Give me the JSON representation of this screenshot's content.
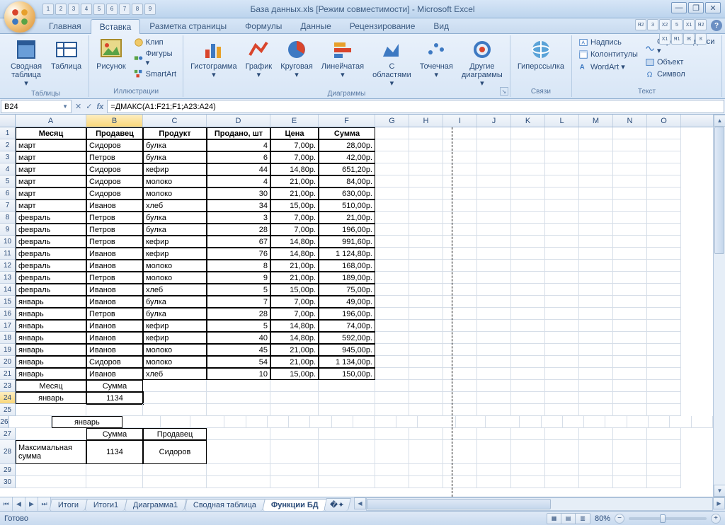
{
  "title": "База данных.xls  [Режим совместимости] - Microsoft Excel",
  "qat": [
    "1",
    "2",
    "3",
    "4",
    "5",
    "6",
    "7",
    "8",
    "9"
  ],
  "qat2": [
    "Я2",
    "3",
    "Х2",
    "5",
    "Х1",
    "Я2"
  ],
  "qat3": [
    "Х1",
    "Я1",
    "Ж",
    "К"
  ],
  "tabs": [
    "Главная",
    "Вставка",
    "Разметка страницы",
    "Формулы",
    "Данные",
    "Рецензирование",
    "Вид"
  ],
  "active_tab": 1,
  "ribbon": {
    "groups": [
      {
        "label": "Таблицы",
        "big": [
          {
            "lbl": "Сводная\nтаблица ▾",
            "icon": "pivot"
          },
          {
            "lbl": "Таблица",
            "icon": "table"
          }
        ]
      },
      {
        "label": "Иллюстрации",
        "big": [
          {
            "lbl": "Рисунок",
            "icon": "pic"
          }
        ],
        "small": [
          {
            "lbl": "Клип",
            "icon": "clip"
          },
          {
            "lbl": "Фигуры ▾",
            "icon": "shapes"
          },
          {
            "lbl": "SmartArt",
            "icon": "smartart"
          }
        ]
      },
      {
        "label": "Диаграммы",
        "big": [
          {
            "lbl": "Гистограмма\n▾",
            "icon": "bar"
          },
          {
            "lbl": "График\n▾",
            "icon": "line"
          },
          {
            "lbl": "Круговая\n▾",
            "icon": "pie"
          },
          {
            "lbl": "Линейчатая\n▾",
            "icon": "hbar"
          },
          {
            "lbl": "С\nобластями ▾",
            "icon": "area"
          },
          {
            "lbl": "Точечная\n▾",
            "icon": "scatter"
          },
          {
            "lbl": "Другие\nдиаграммы ▾",
            "icon": "other"
          }
        ],
        "launcher": true
      },
      {
        "label": "Связи",
        "big": [
          {
            "lbl": "Гиперссылка",
            "icon": "link"
          }
        ]
      },
      {
        "label": "Текст",
        "small2": [
          {
            "lbl": "Надпись",
            "icon": "textbox"
          },
          {
            "lbl": "Колонтитулы",
            "icon": "headerfooter"
          },
          {
            "lbl": "WordArt ▾",
            "icon": "wordart"
          },
          {
            "lbl": "Строка подписи ▾",
            "icon": "sig"
          },
          {
            "lbl": "Объект",
            "icon": "object"
          },
          {
            "lbl": "Символ",
            "icon": "symbol"
          }
        ]
      }
    ]
  },
  "name_box": "B24",
  "formula": "=ДМАКС(A1:F21;F1;A23:A24)",
  "columns": [
    "A",
    "B",
    "C",
    "D",
    "E",
    "F",
    "G",
    "H",
    "I",
    "J",
    "K",
    "L",
    "M",
    "N",
    "O"
  ],
  "col_classes": [
    "cA",
    "cB",
    "cC",
    "cD",
    "cE",
    "cF",
    "cG",
    "cH",
    "cI",
    "cJ",
    "cK",
    "cL",
    "cM",
    "cN",
    "cO"
  ],
  "headers": [
    "Месяц",
    "Продавец",
    "Продукт",
    "Продано, шт",
    "Цена",
    "Сумма"
  ],
  "rows": [
    [
      "март",
      "Сидоров",
      "булка",
      "4",
      "7,00р.",
      "28,00р."
    ],
    [
      "март",
      "Петров",
      "булка",
      "6",
      "7,00р.",
      "42,00р."
    ],
    [
      "март",
      "Сидоров",
      "кефир",
      "44",
      "14,80р.",
      "651,20р."
    ],
    [
      "март",
      "Сидоров",
      "молоко",
      "4",
      "21,00р.",
      "84,00р."
    ],
    [
      "март",
      "Сидоров",
      "молоко",
      "30",
      "21,00р.",
      "630,00р."
    ],
    [
      "март",
      "Иванов",
      "хлеб",
      "34",
      "15,00р.",
      "510,00р."
    ],
    [
      "февраль",
      "Петров",
      "булка",
      "3",
      "7,00р.",
      "21,00р."
    ],
    [
      "февраль",
      "Петров",
      "булка",
      "28",
      "7,00р.",
      "196,00р."
    ],
    [
      "февраль",
      "Петров",
      "кефир",
      "67",
      "14,80р.",
      "991,60р."
    ],
    [
      "февраль",
      "Иванов",
      "кефир",
      "76",
      "14,80р.",
      "1 124,80р."
    ],
    [
      "февраль",
      "Иванов",
      "молоко",
      "8",
      "21,00р.",
      "168,00р."
    ],
    [
      "февраль",
      "Петров",
      "молоко",
      "9",
      "21,00р.",
      "189,00р."
    ],
    [
      "февраль",
      "Иванов",
      "хлеб",
      "5",
      "15,00р.",
      "75,00р."
    ],
    [
      "январь",
      "Иванов",
      "булка",
      "7",
      "7,00р.",
      "49,00р."
    ],
    [
      "январь",
      "Петров",
      "булка",
      "28",
      "7,00р.",
      "196,00р."
    ],
    [
      "январь",
      "Иванов",
      "кефир",
      "5",
      "14,80р.",
      "74,00р."
    ],
    [
      "январь",
      "Иванов",
      "кефир",
      "40",
      "14,80р.",
      "592,00р."
    ],
    [
      "январь",
      "Иванов",
      "молоко",
      "45",
      "21,00р.",
      "945,00р."
    ],
    [
      "январь",
      "Сидоров",
      "молоко",
      "54",
      "21,00р.",
      "1 134,00р."
    ],
    [
      "январь",
      "Иванов",
      "хлеб",
      "10",
      "15,00р.",
      "150,00р."
    ]
  ],
  "crit_header": [
    "Месяц",
    "Сумма"
  ],
  "crit_row": [
    "январь",
    "1134"
  ],
  "summary_title": "январь",
  "summary_header": [
    "Сумма",
    "Продавец"
  ],
  "summary_label": "Максимальная сумма",
  "summary_vals": [
    "1134",
    "Сидоров"
  ],
  "sheet_tabs": [
    "Итоги",
    "Итоги1",
    "Диаграмма1",
    "Сводная таблица",
    "Функции БД"
  ],
  "active_sheet": 4,
  "status": "Готово",
  "zoom": "80%"
}
